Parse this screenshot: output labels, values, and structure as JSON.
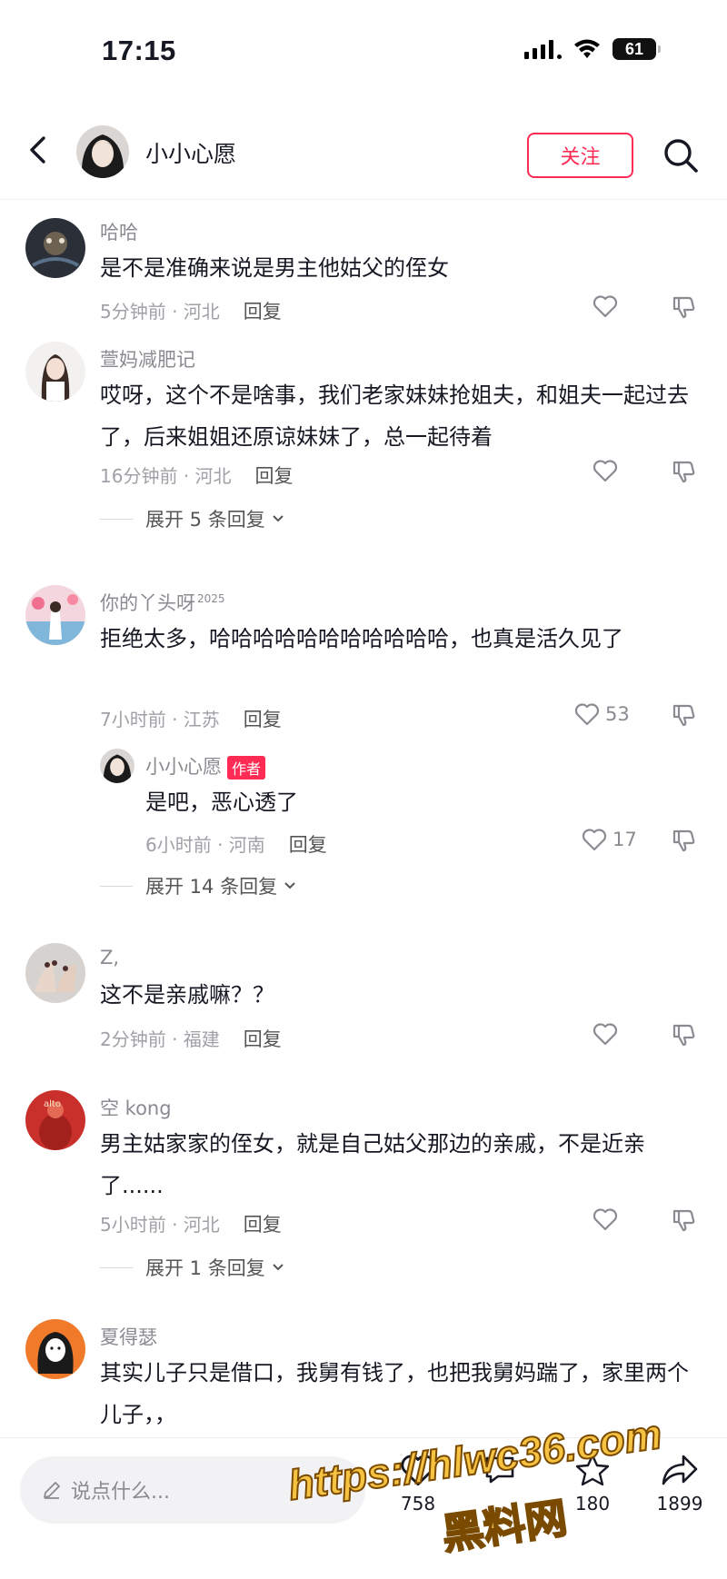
{
  "status_bar": {
    "time": "17:15",
    "battery": "61"
  },
  "header": {
    "name": "小小心愿",
    "follow_label": "关注"
  },
  "comments": [
    {
      "user": "哈哈",
      "text": "是不是准确来说是男主他姑父的侄女",
      "time": "5分钟前 · 河北",
      "reply": "回复",
      "likes": ""
    },
    {
      "user": "萱妈减肥记",
      "text": "哎呀，这个不是啥事，我们老家妹妹抢姐夫，和姐夫一起过去了，后来姐姐还原谅妹妹了，总一起待着",
      "time": "16分钟前 · 河北",
      "reply": "回复",
      "likes": "",
      "expand": "展开 5 条回复"
    },
    {
      "user": "你的丫头呀",
      "user_sup": "2025",
      "text": "拒绝太多，哈哈哈哈哈哈哈哈哈哈哈，也真是活久见了",
      "time": "7小时前 · 江苏",
      "reply": "回复",
      "likes": "53",
      "sub": {
        "user": "小小心愿",
        "badge": "作者",
        "text": "是吧，恶心透了",
        "time": "6小时前 · 河南",
        "reply": "回复",
        "likes": "17"
      },
      "expand": "展开 14 条回复"
    },
    {
      "user": "Z,",
      "text": "这不是亲戚嘛？？",
      "time": "2分钟前 · 福建",
      "reply": "回复",
      "likes": ""
    },
    {
      "user": "空 kong",
      "text": "男主姑家家的侄女，就是自己姑父那边的亲戚，不是近亲了......",
      "time": "5小时前 · 河北",
      "reply": "回复",
      "likes": "",
      "expand": "展开 1 条回复"
    },
    {
      "user": "夏得瑟",
      "text": "其实儿子只是借口，我舅有钱了，也把我舅妈踹了，家里两个儿子，，",
      "time": "",
      "reply": "",
      "likes": ""
    }
  ],
  "bottom_bar": {
    "placeholder": "说点什么...",
    "like_count": "758",
    "comment_count": "",
    "fav_count": "180",
    "share_count": "1899"
  },
  "watermark": {
    "url": "https://hlwc36.com",
    "name": "黑料网"
  },
  "colors": {
    "accent": "#fe2c55",
    "text": "#161823",
    "secondary": "#8a8b91"
  }
}
